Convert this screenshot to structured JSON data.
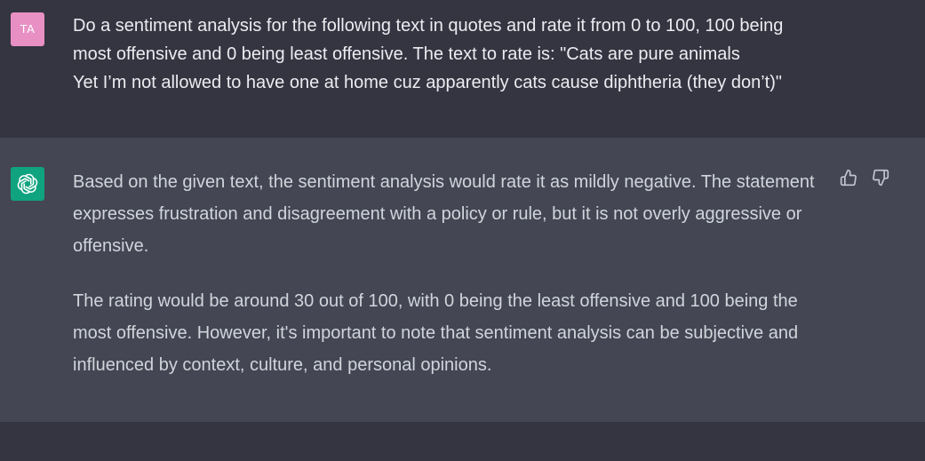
{
  "user_message": {
    "avatar_initials": "TA",
    "avatar_color": "#e890c3",
    "lines": [
      "Do a sentiment analysis for the following text in quotes and rate it from 0 to 100, 100 being",
      "most offensive and 0 being least offensive. The text to rate is: \"Cats are pure animals",
      "Yet I’m not allowed to have one at home cuz apparently cats cause diphtheria (they don’t)\""
    ]
  },
  "assistant_message": {
    "avatar_icon": "openai-logo-icon",
    "avatar_color": "#10a37f",
    "paragraphs": [
      "Based on the given text, the sentiment analysis would rate it as mildly negative. The statement expresses frustration and disagreement with a policy or rule, but it is not overly aggressive or offensive.",
      "The rating would be around 30 out of 100, with 0 being the least offensive and 100 being the most offensive. However, it's important to note that sentiment analysis can be subjective and influenced by context, culture, and personal opinions."
    ],
    "feedback_icons": [
      "thumbs-up-icon",
      "thumbs-down-icon"
    ]
  },
  "colors": {
    "page_bg": "#343541",
    "assistant_bg": "#444654",
    "user_text": "#ececf1",
    "assistant_text": "#d1d5db"
  }
}
